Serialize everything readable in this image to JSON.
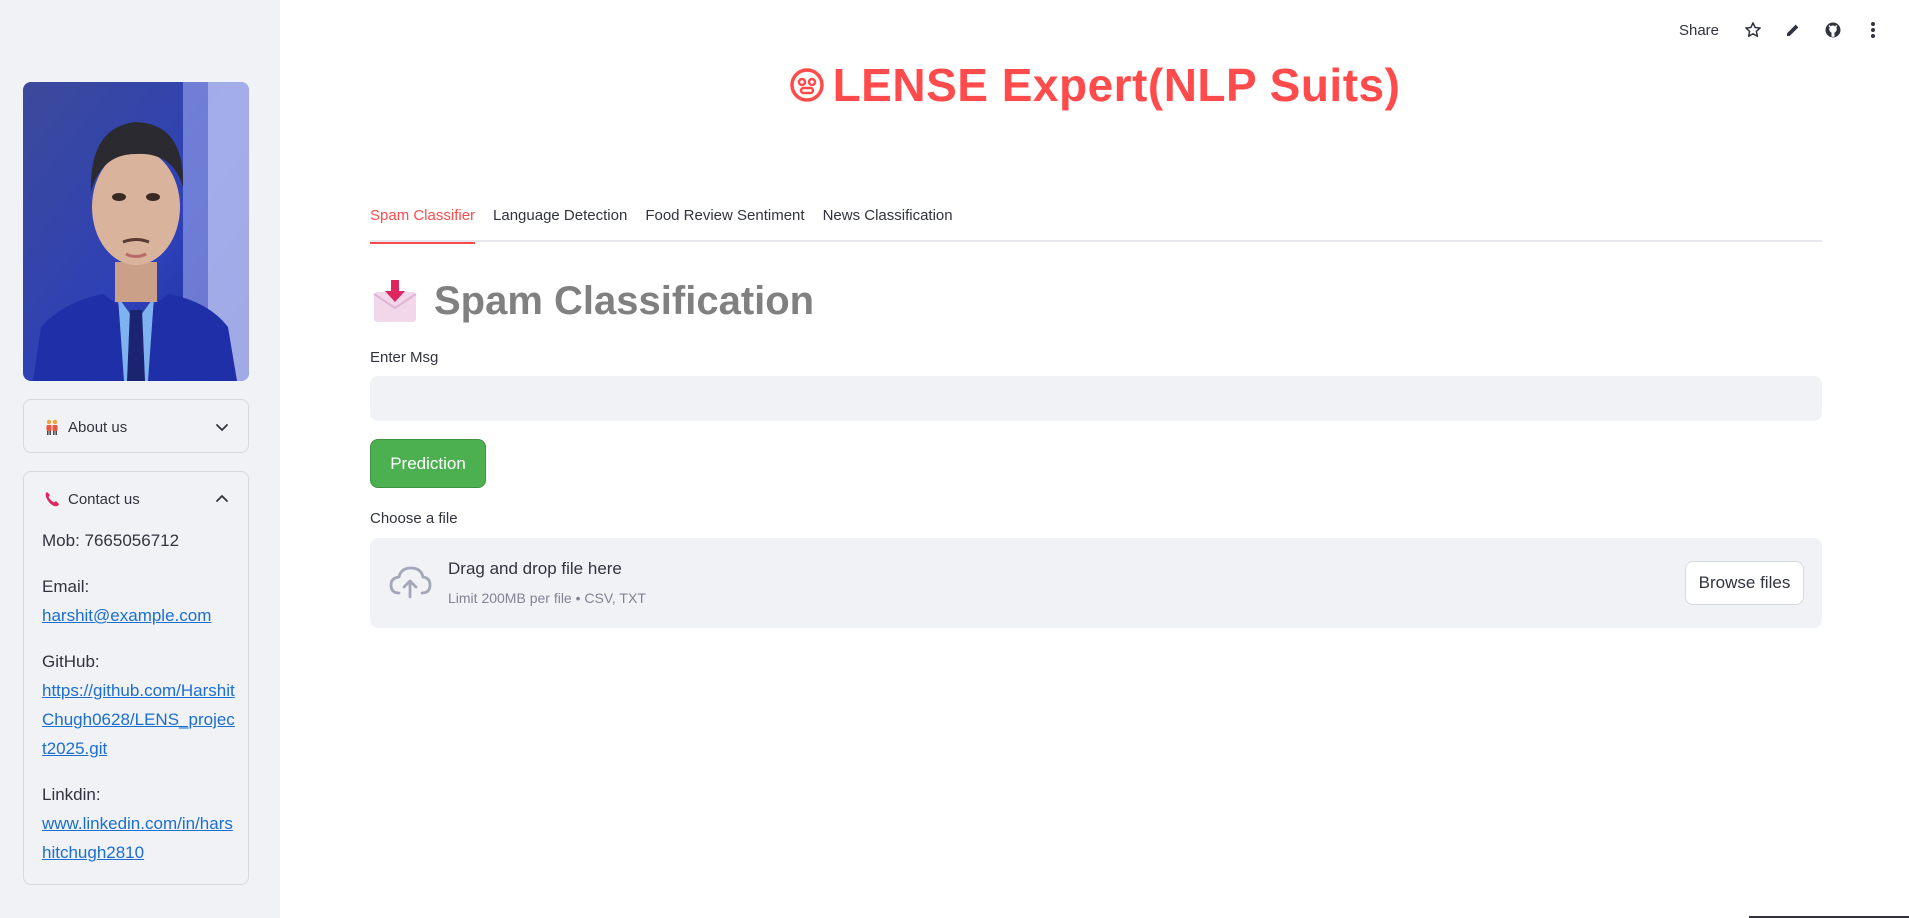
{
  "sidebar": {
    "about": {
      "label": "About us",
      "icon": "people-emoji-icon"
    },
    "contact": {
      "label": "Contact us",
      "icon": "telephone-emoji-icon",
      "mob": "Mob: 7665056712",
      "email_label": "Email:",
      "email": "harshit@example.com",
      "github_label": "GitHub:",
      "github": "https://github.com/HarshitChugh0628/LENS_project2025.git",
      "linkedin_label": "Linkdin:",
      "linkedin": "www.linkedin.com/in/harshitchugh2810"
    }
  },
  "toolbar": {
    "share": "Share",
    "icons": [
      "star-icon",
      "pencil-icon",
      "github-icon",
      "more-vertical-icon"
    ]
  },
  "header": {
    "title": "LENSE Expert(NLP Suits)"
  },
  "tabs": [
    {
      "label": "Spam Classifier",
      "active": true
    },
    {
      "label": "Language Detection",
      "active": false
    },
    {
      "label": "Food Review Sentiment",
      "active": false
    },
    {
      "label": "News Classification",
      "active": false
    }
  ],
  "section": {
    "title": "Spam Classification"
  },
  "form": {
    "msg_label": "Enter Msg",
    "msg_value": "",
    "predict_label": "Prediction",
    "file_label": "Choose a file",
    "dropzone_main": "Drag and drop file here",
    "dropzone_sub": "Limit 200MB per file • CSV, TXT",
    "browse_label": "Browse files"
  },
  "colors": {
    "accent": "#ff4b4b",
    "button_green": "#4caf50",
    "link": "#1c6ecf",
    "sidebar_bg": "#f0f2f6"
  }
}
